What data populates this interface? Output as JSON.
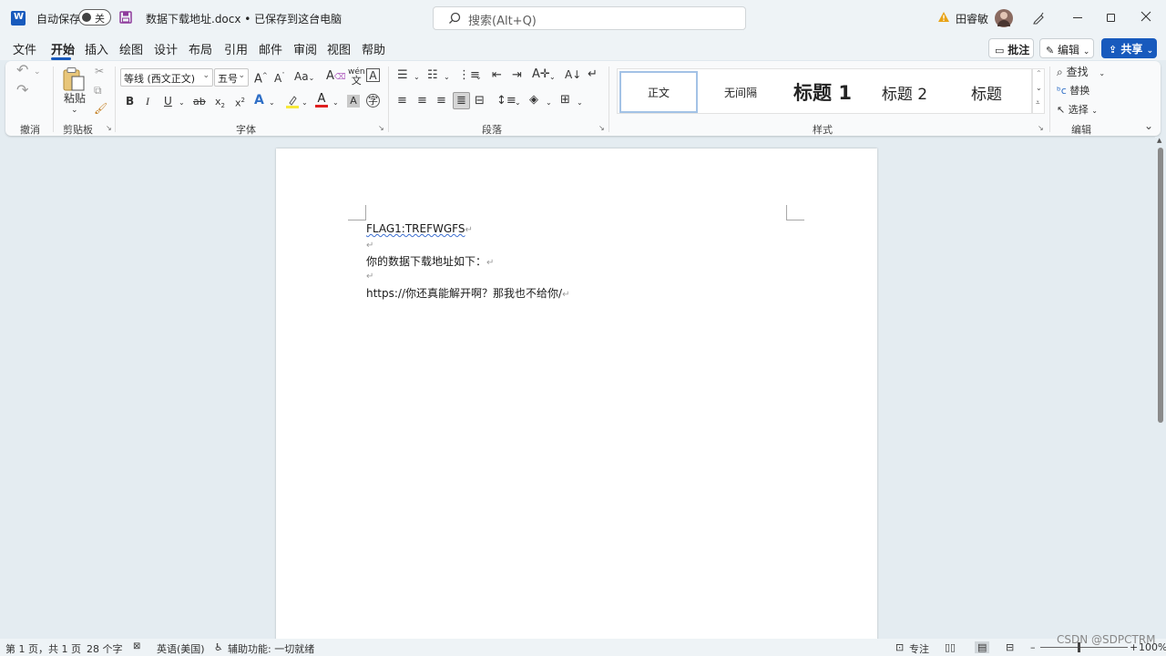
{
  "titlebar": {
    "autosave_label": "自动保存",
    "autosave_state": "关",
    "doc_title": "数据下载地址.docx • 已保存到这台电脑",
    "search_placeholder": "搜索(Alt+Q)",
    "user_name": "田睿敏",
    "colors": {
      "word_blue": "#185abd",
      "save_purple": "#8e3a9b",
      "warning": "#e8a317"
    }
  },
  "menu": {
    "tabs": [
      "文件",
      "开始",
      "插入",
      "绘图",
      "设计",
      "布局",
      "引用",
      "邮件",
      "审阅",
      "视图",
      "帮助"
    ],
    "active_tab": "开始",
    "comment_label": "批注",
    "edit_label": "编辑",
    "share_label": "共享"
  },
  "ribbon": {
    "undo_group": "撤消",
    "clipboard_group": "剪贴板",
    "paste_label": "粘贴",
    "font_group": "字体",
    "font_name": "等线 (西文正文)",
    "font_size": "五号",
    "paragraph_group": "段落",
    "styles_group": "样式",
    "styles": [
      "正文",
      "无间隔",
      "标题 1",
      "标题 2",
      "标题"
    ],
    "editing_group": "编辑",
    "find_label": "查找",
    "replace_label": "替换",
    "select_label": "选择",
    "bold": "B",
    "italic": "I",
    "underline": "U",
    "strike": "ab"
  },
  "document": {
    "lines": [
      "FLAG1:TREFWGFS",
      "",
      "你的数据下载地址如下：",
      "",
      "https://你还真能解开啊？那我也不给你/"
    ]
  },
  "statusbar": {
    "page_info": "第 1 页，共 1 页",
    "word_count": "28 个字",
    "language": "英语(美国)",
    "accessibility": "辅助功能: 一切就绪",
    "focus": "专注",
    "zoom": "100%",
    "watermark": "CSDN @SDPCTRM"
  }
}
